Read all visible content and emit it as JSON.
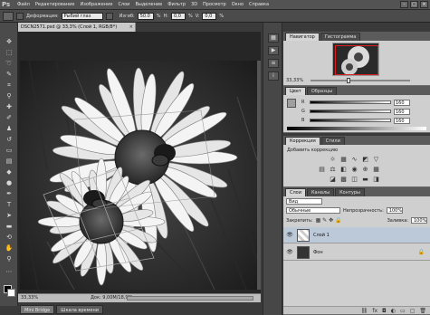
{
  "app": {
    "logo": "Ps"
  },
  "menu": [
    "Файл",
    "Редактирование",
    "Изображение",
    "Слои",
    "Выделение",
    "Фильтр",
    "3D",
    "Просмотр",
    "Окно",
    "Справка"
  ],
  "window_controls": {
    "minimize": "–",
    "restore": "□",
    "close": "×"
  },
  "options": {
    "mode_label": "Деформация:",
    "mode_value": "Рыбий глаз",
    "bend_label": "Изгиб:",
    "bend_value": "50.0",
    "percent": "%",
    "h_label": "H:",
    "h_value": "0,0",
    "v_label": "V:",
    "v_value": "0,0"
  },
  "document": {
    "tab_title": "DSCN2571.psd @ 33,3% (Слой 1, RGB/8*)",
    "close": "×",
    "zoom": "33,33%",
    "doc_size": "Док: 9,00М/18,9М"
  },
  "bottom_tabs": [
    "Mini Bridge",
    "Шкала времени"
  ],
  "navigator": {
    "tabs": [
      "Навигатор",
      "Гистограмма"
    ],
    "zoom": "33,33%"
  },
  "color": {
    "tabs": [
      "Цвет",
      "Образцы"
    ],
    "channels": [
      {
        "name": "R",
        "value": "160"
      },
      {
        "name": "G",
        "value": "160"
      },
      {
        "name": "B",
        "value": "160"
      }
    ]
  },
  "corrections": {
    "tabs": [
      "Коррекция",
      "Стили"
    ],
    "title": "Добавить коррекцию"
  },
  "layers": {
    "tabs": [
      "Слои",
      "Каналы",
      "Контуры"
    ],
    "kind_label": "Вид",
    "blend_mode": "Обычные",
    "opacity_label": "Непрозрачность:",
    "opacity_value": "100%",
    "lock_label": "Закрепить:",
    "fill_label": "Заливка:",
    "fill_value": "100%",
    "items": [
      {
        "name": "Слой 1",
        "selected": true
      },
      {
        "name": "Фон",
        "selected": false
      }
    ],
    "footer_icons": [
      "link-icon",
      "fx-icon",
      "mask-icon",
      "adjustment-icon",
      "folder-icon",
      "new-layer-icon",
      "trash-icon"
    ]
  },
  "colors": {
    "menu_bg": "#535353",
    "panel_bg": "#cfcfcf",
    "canvas_bg": "#262626",
    "nav_box": "#d82020"
  }
}
